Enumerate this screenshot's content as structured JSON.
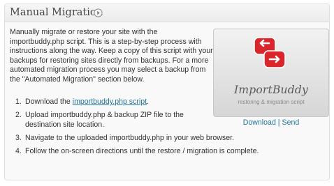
{
  "panel": {
    "title": "Manual Migration",
    "toggle_icon": "circle-arrow-right-icon"
  },
  "intro": {
    "text": "Manually migrate or restore your site with the importbuddy.php script. This is a step-by-step process with instructions along the way. Keep a copy of this script with your backups for restoring sites directly from backups. For a more automated migration process you may select a backup from the \"Automated Migration\" section below."
  },
  "steps": [
    {
      "num": "1.",
      "prefix": "Download the ",
      "link": "importbuddy.php script",
      "suffix": "."
    },
    {
      "num": "2.",
      "line1": "Upload importbuddy.php & backup ZIP file to the",
      "line2": "destination site location."
    },
    {
      "num": "3.",
      "text": "Navigate to the uploaded importbuddy.php in your web browser."
    },
    {
      "num": "4.",
      "text": "Follow the on-screen directions until the restore / migration is complete."
    }
  ],
  "promo": {
    "icon": "importbuddy-logo-icon",
    "name": "ImportBuddy",
    "tagline": "restoring & migration script",
    "download_label": "Download",
    "separator": "|",
    "send_label": "Send"
  },
  "colors": {
    "link": "#21759b",
    "text": "#333333",
    "logo_red": "#d9262c"
  }
}
